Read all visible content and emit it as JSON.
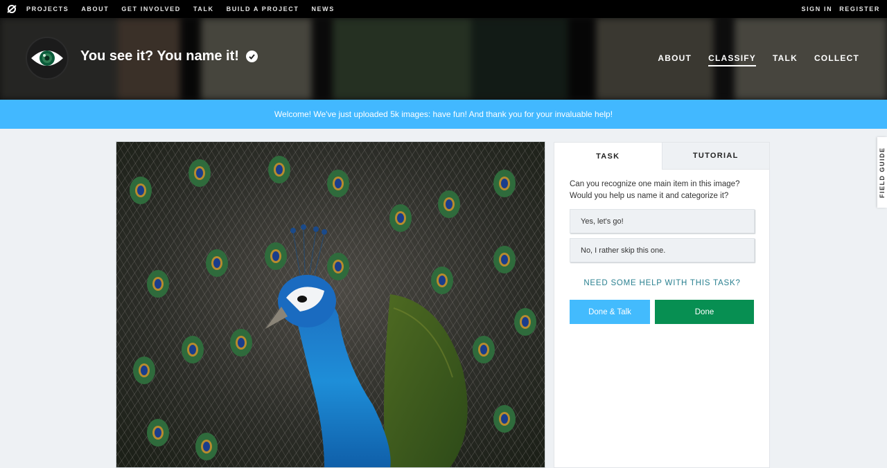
{
  "topbar": {
    "nav": [
      "PROJECTS",
      "ABOUT",
      "GET INVOLVED",
      "TALK",
      "BUILD A PROJECT",
      "NEWS"
    ],
    "sign_in": "SIGN IN",
    "register": "REGISTER"
  },
  "project": {
    "title": "You see it? You name it!",
    "nav": [
      "ABOUT",
      "CLASSIFY",
      "TALK",
      "COLLECT"
    ],
    "active_nav": "CLASSIFY"
  },
  "banner": {
    "message": "Welcome! We've just uploaded 5k images: have fun! And thank you for your invaluable help!"
  },
  "task_panel": {
    "tabs": [
      "TASK",
      "TUTORIAL"
    ],
    "question_line1": "Can you recognize one main item in this image?",
    "question_line2": "Would you help us name it and categorize it?",
    "answers": [
      "Yes, let's go!",
      "No, I rather skip this one."
    ],
    "help_link": "NEED SOME HELP WITH THIS TASK?",
    "done_talk_label": "Done & Talk",
    "done_label": "Done"
  },
  "field_guide": {
    "label": "FIELD GUIDE"
  },
  "colors": {
    "banner": "#42b8ff",
    "done_talk": "#43bbfd",
    "done": "#078f52",
    "help_link": "#2a8090"
  },
  "icons": {
    "logo": "zooniverse-logo-icon",
    "avatar": "eye-icon",
    "verified": "check-circle-icon"
  }
}
